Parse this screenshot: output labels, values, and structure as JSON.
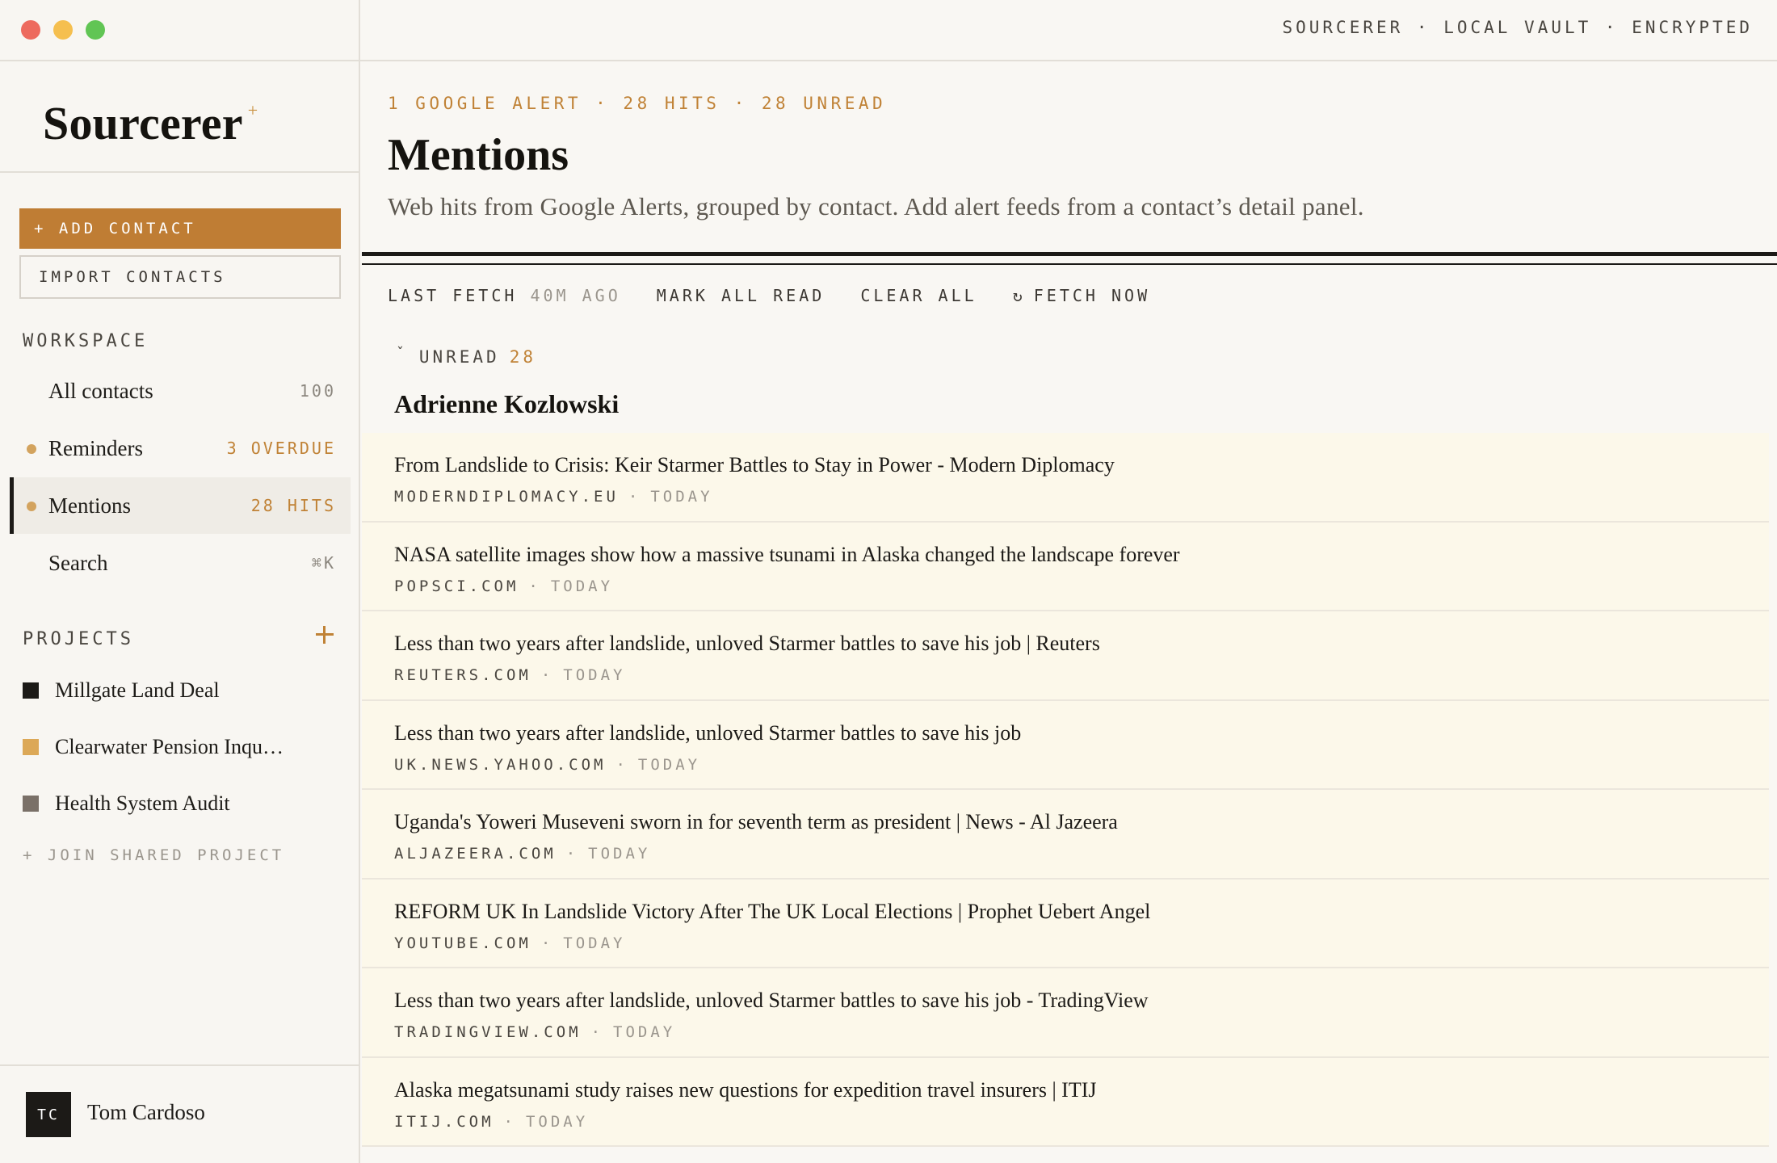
{
  "window": {
    "status": "SOURCERER · LOCAL VAULT · ENCRYPTED"
  },
  "sidebar": {
    "logo": "Sourcerer",
    "logo_mark": "+",
    "add_contact": "+ ADD CONTACT",
    "import_contacts": "IMPORT CONTACTS",
    "workspace_head": "WORKSPACE",
    "nav": [
      {
        "label": "All contacts",
        "count": "100"
      },
      {
        "label": "Reminders",
        "count": "3 OVERDUE"
      },
      {
        "label": "Mentions",
        "count": "28 HITS"
      },
      {
        "label": "Search",
        "count": "⌘K"
      }
    ],
    "projects_head": "PROJECTS",
    "projects": [
      {
        "name": "Millgate Land Deal",
        "color": "#1c1a17"
      },
      {
        "name": "Clearwater Pension Inqu…",
        "color": "#dca857"
      },
      {
        "name": "Health System Audit",
        "color": "#7a7068"
      }
    ],
    "join_shared": "+ JOIN SHARED PROJECT",
    "user": {
      "initials": "TC",
      "name": "Tom Cardoso"
    }
  },
  "main": {
    "eyebrow": "1 GOOGLE ALERT · 28 HITS · 28 UNREAD",
    "title": "Mentions",
    "subtitle": "Web hits from Google Alerts, grouped by contact. Add alert feeds from a contact’s detail panel.",
    "toolbar": {
      "last_fetch_label": "LAST FETCH",
      "last_fetch_value": "40M AGO",
      "mark_all_read": "MARK ALL READ",
      "clear_all": "CLEAR ALL",
      "fetch_now": "FETCH NOW"
    },
    "group": {
      "label": "UNREAD",
      "count": "28"
    },
    "contact": "Adrienne Kozlowski",
    "hits": [
      {
        "title": "From Landslide to Crisis: Keir Starmer Battles to Stay in Power - Modern Diplomacy",
        "domain": "MODERNDIPLOMACY.EU",
        "when": "TODAY"
      },
      {
        "title": "NASA satellite images show how a massive tsunami in Alaska changed the landscape forever",
        "domain": "POPSCI.COM",
        "when": "TODAY"
      },
      {
        "title": "Less than two years after landslide, unloved Starmer battles to save his job | Reuters",
        "domain": "REUTERS.COM",
        "when": "TODAY"
      },
      {
        "title": "Less than two years after landslide, unloved Starmer battles to save his job",
        "domain": "UK.NEWS.YAHOO.COM",
        "when": "TODAY"
      },
      {
        "title": "Uganda's Yoweri Museveni sworn in for seventh term as president | News - Al Jazeera",
        "domain": "ALJAZEERA.COM",
        "when": "TODAY"
      },
      {
        "title": "REFORM UK In Landslide Victory After The UK Local Elections | Prophet Uebert Angel",
        "domain": "YOUTUBE.COM",
        "when": "TODAY"
      },
      {
        "title": "Less than two years after landslide, unloved Starmer battles to save his job - TradingView",
        "domain": "TRADINGVIEW.COM",
        "when": "TODAY"
      },
      {
        "title": "Alaska megatsunami study raises new questions for expedition travel insurers | ITIJ",
        "domain": "ITIJ.COM",
        "when": "TODAY"
      }
    ]
  }
}
